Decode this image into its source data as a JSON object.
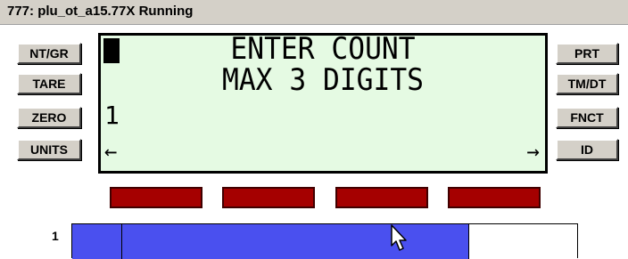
{
  "window": {
    "title": "777: plu_ot_a15.77X Running"
  },
  "left_buttons": [
    {
      "label": "NT/GR"
    },
    {
      "label": "TARE"
    },
    {
      "label": "ZERO"
    },
    {
      "label": "UNITS"
    }
  ],
  "right_buttons": [
    {
      "label": "PRT"
    },
    {
      "label": "TM/DT"
    },
    {
      "label": "FNCT"
    },
    {
      "label": "ID"
    }
  ],
  "display": {
    "line1": "ENTER COUNT",
    "line2": "MAX 3 DIGITS",
    "input_value": "1",
    "left_arrow": "←",
    "right_arrow": "→"
  },
  "softkeys": {
    "count": 4,
    "color": "#a50000"
  },
  "track": {
    "label": "1",
    "fill_color": "#4a50ef",
    "filled_fraction": 0.785
  },
  "colors": {
    "lcd_background": "#e5fae3",
    "window_chrome": "#d4d0c8"
  }
}
